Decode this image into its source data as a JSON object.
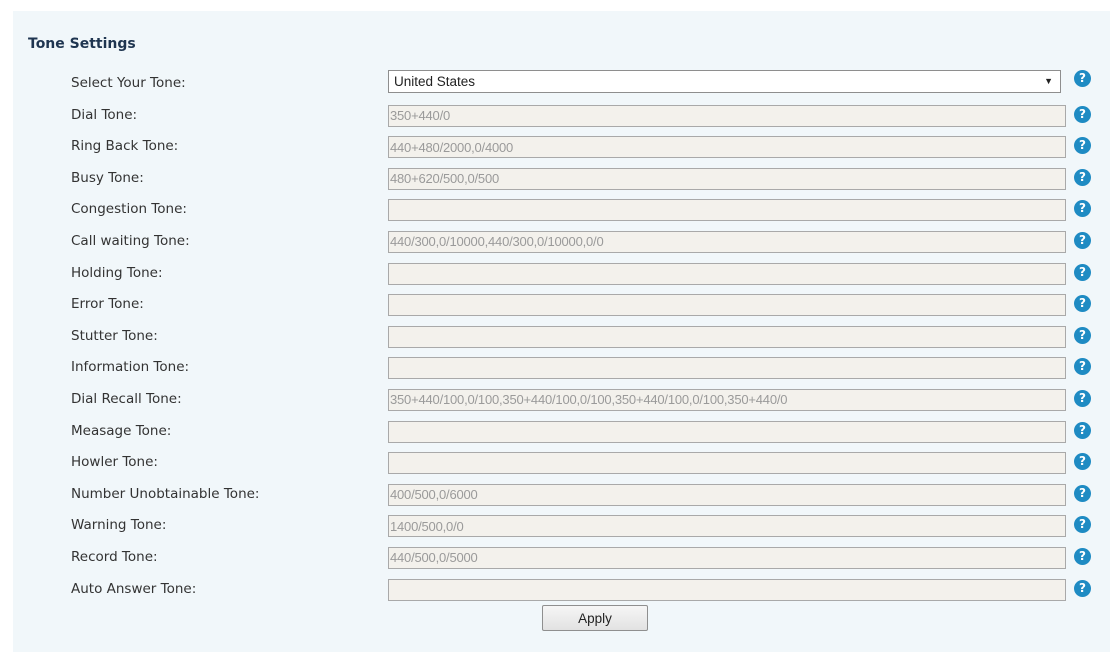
{
  "section": {
    "title": "Tone Settings"
  },
  "select": {
    "label": "Select Your Tone:",
    "value": "United States",
    "arrow": "▼",
    "help_icon": "question-circle-icon"
  },
  "rows": [
    {
      "label": "Dial Tone:",
      "value": "350+440/0"
    },
    {
      "label": "Ring Back Tone:",
      "value": "440+480/2000,0/4000"
    },
    {
      "label": "Busy Tone:",
      "value": "480+620/500,0/500"
    },
    {
      "label": "Congestion Tone:",
      "value": ""
    },
    {
      "label": "Call waiting Tone:",
      "value": "440/300,0/10000,440/300,0/10000,0/0"
    },
    {
      "label": "Holding Tone:",
      "value": ""
    },
    {
      "label": "Error Tone:",
      "value": ""
    },
    {
      "label": "Stutter Tone:",
      "value": ""
    },
    {
      "label": "Information Tone:",
      "value": ""
    },
    {
      "label": "Dial Recall Tone:",
      "value": "350+440/100,0/100,350+440/100,0/100,350+440/100,0/100,350+440/0"
    },
    {
      "label": "Measage Tone:",
      "value": ""
    },
    {
      "label": "Howler Tone:",
      "value": ""
    },
    {
      "label": "Number Unobtainable Tone:",
      "value": "400/500,0/6000"
    },
    {
      "label": "Warning Tone:",
      "value": "1400/500,0/0"
    },
    {
      "label": "Record Tone:",
      "value": "440/500,0/5000"
    },
    {
      "label": "Auto Answer Tone:",
      "value": ""
    }
  ],
  "help_glyph": "?",
  "apply_label": "Apply",
  "colors": {
    "panel_background": "#f1f7fa",
    "help_icon": "#1f8bc3",
    "title": "#1f3550",
    "disabled_field": "#f3f1ec"
  }
}
